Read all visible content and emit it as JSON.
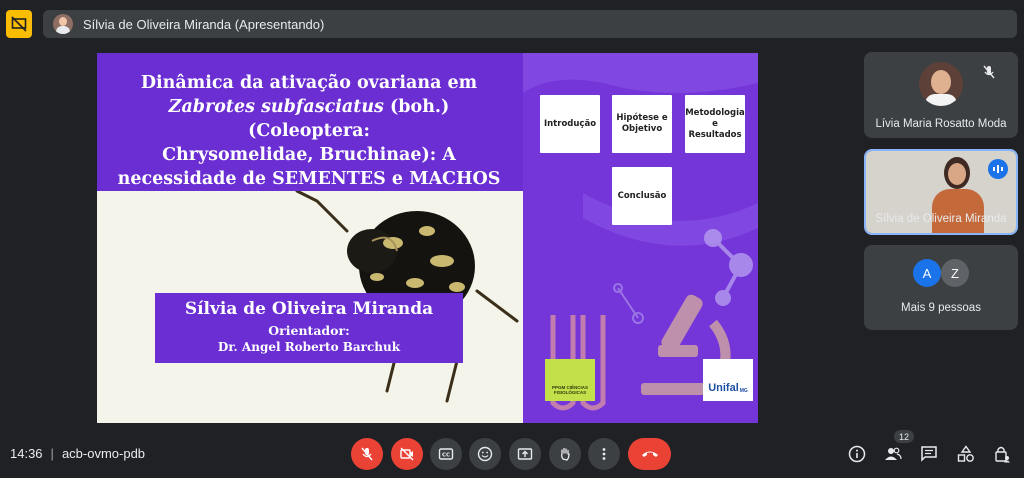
{
  "presenter_bar": {
    "label": "Sílvia de Oliveira Miranda (Apresentando)"
  },
  "slide": {
    "title_line1": "Dinâmica da ativação ovariana em",
    "title_line2_italic": "Zabrotes subfasciatus",
    "title_line2_rest": " (boh.) (Coleoptera:",
    "title_line3": "Chrysomelidae, Bruchinae): A",
    "title_line4": "necessidade de SEMENTES e MACHOS",
    "nav_cards": [
      "Introdução",
      "Hipótese e Objetivo",
      "Metodologia e Resultados",
      "Conclusão"
    ],
    "author_name": "Sílvia de Oliveira Miranda",
    "advisor_label": "Orientador:",
    "advisor_name": "Dr. Angel Roberto Barchuk",
    "logo_ppgcf": "PPGM CIÊNCIAS FISIOLÓGICAS",
    "logo_unifal": "Unifal",
    "logo_unifal_suffix": "MG"
  },
  "participants": [
    {
      "name": "Lívia Maria Rosatto Moda",
      "muted": true
    },
    {
      "name": "Sílvia de Oliveira Miranda",
      "speaking": true
    }
  ],
  "more_people": {
    "avatars": [
      "A",
      "Z"
    ],
    "avatar_colors": [
      "#1a73e8",
      "#5f6368"
    ],
    "label": "Mais 9 pessoas"
  },
  "bottom_bar": {
    "time": "14:36",
    "separator": "|",
    "meeting_code": "acb-ovmo-pdb",
    "people_count": "12"
  },
  "colors": {
    "accent_red": "#ea4335",
    "present_yellow": "#fbbc04",
    "slide_purple": "#6a2ed2",
    "speaking_blue": "#8ab4f8"
  }
}
